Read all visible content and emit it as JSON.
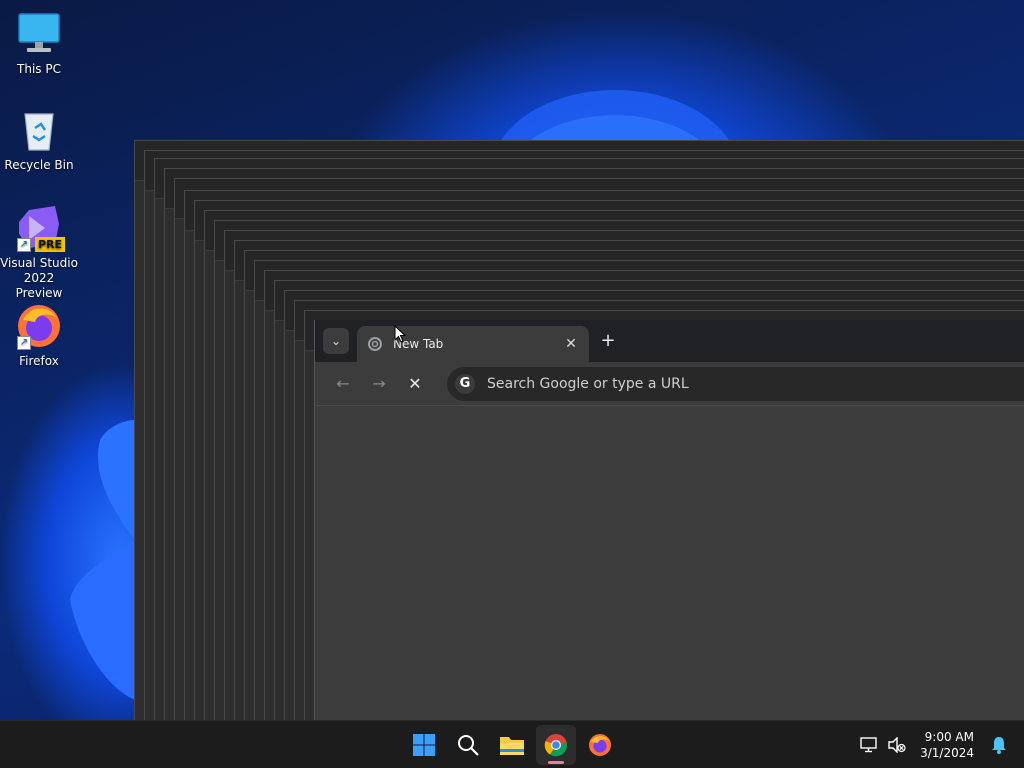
{
  "desktop": {
    "icons": [
      {
        "label": "This PC",
        "icon": "computer-icon"
      },
      {
        "label": "Recycle Bin",
        "icon": "recycle-bin-icon"
      },
      {
        "label": "Visual Studio 2022 Preview",
        "icon": "visual-studio-icon",
        "badge": "PRE"
      },
      {
        "label": "Firefox",
        "icon": "firefox-icon"
      }
    ]
  },
  "browser": {
    "tab": {
      "title": "New Tab",
      "close_glyph": "✕"
    },
    "new_tab_glyph": "+",
    "tab_search_glyph": "⌄",
    "nav": {
      "back": "←",
      "forward": "→",
      "stop": "✕"
    },
    "omnibox": {
      "placeholder": "Search Google or type a URL",
      "engine_glyph": "G"
    }
  },
  "taskbar": {
    "apps": [
      "start-icon",
      "search-icon",
      "file-explorer-icon",
      "chrome-icon",
      "firefox-icon"
    ],
    "clock": {
      "time": "9:00 AM",
      "date": "3/1/2024"
    }
  },
  "colors": {
    "accent": "#0b57d0",
    "taskbar_bg": "#1c1c1c",
    "browser_bg": "#3c3c3c",
    "tab_strip": "#202124"
  }
}
